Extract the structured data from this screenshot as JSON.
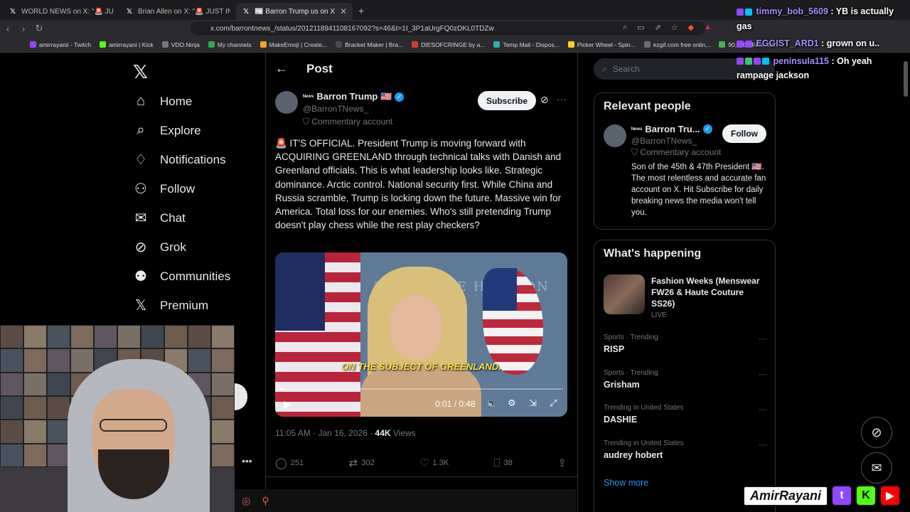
{
  "browser": {
    "tabs": [
      {
        "title": "WORLD NEWS on X: \"🚨 JUST IN:",
        "active": false
      },
      {
        "title": "Brian Allen on X: \"🚨 JUST IN: Xi Jinp",
        "active": false
      },
      {
        "title": "📰 Barron Trump us on X: \"🚨 I",
        "active": true
      }
    ],
    "url": "x.com/barrontnews_/status/2012118941108167092?s=46&t=1I_3P1aUrgFQ0zDKL0TDZw",
    "bookmarks": [
      {
        "label": "amirrayanii - Twitch",
        "color": "#9146ff"
      },
      {
        "label": "amirrayani | Kick",
        "color": "#53fc18"
      },
      {
        "label": "VDO.Ninja",
        "color": "#777777"
      },
      {
        "label": "My channels",
        "color": "#34a853"
      },
      {
        "label": "MakeEmoji | Create...",
        "color": "#f4a31b"
      },
      {
        "label": "Bracket Maker | Bra...",
        "color": "#4a4a4a"
      },
      {
        "label": "DIESOFCRINGE by a...",
        "color": "#d33b3b"
      },
      {
        "label": "Temp Mail - Dispos...",
        "color": "#2ab1a8"
      },
      {
        "label": "Picker Wheel - Spin...",
        "color": "#f4d21b"
      },
      {
        "label": "ezgif.com free onlin...",
        "color": "#6d6d6d"
      },
      {
        "label": "90,000+ Free So...",
        "color": "#4caf50"
      }
    ]
  },
  "nav": {
    "items": [
      {
        "label": "Home",
        "icon": "⌂"
      },
      {
        "label": "Explore",
        "icon": "⌕"
      },
      {
        "label": "Notifications",
        "icon": "♢"
      },
      {
        "label": "Follow",
        "icon": "⚇"
      },
      {
        "label": "Chat",
        "icon": "✉"
      },
      {
        "label": "Grok",
        "icon": "⊘"
      },
      {
        "label": "Communities",
        "icon": "⚉"
      },
      {
        "label": "Premium",
        "icon": "𝕏"
      }
    ]
  },
  "post": {
    "header_title": "Post",
    "author_name": "Barron Trump 🇺🇸",
    "author_prefix": "ᴺᵉʷˢ",
    "handle": "@BarronTNews_",
    "account_type": "Commentary account",
    "subscribe_label": "Subscribe",
    "body": "🚨 IT'S OFFICIAL. President Trump is moving forward with ACQUIRING GREENLAND through technical talks with Danish and Greenland officials. This is what leadership looks like. Strategic dominance. Arctic control. National security first. While China and Russia scramble, Trump is locking down the future. Massive win for America. Total loss for our enemies. Who's still pretending Trump doesn't play chess while the rest play checkers?",
    "video": {
      "caption": "ON THE SUBJECT OF GREENLAND.",
      "wall_text": "THE WHITE HO     GTON",
      "time": "0:01 / 0:48",
      "progress": 0.02
    },
    "timestamp": "11:05 AM · Jan 16, 2026 · ",
    "views_count": "44K",
    "views_label": " Views",
    "replies": "251",
    "reposts": "302",
    "likes": "1.3K",
    "bookmarks": "38"
  },
  "search": {
    "placeholder": "Search"
  },
  "relevant": {
    "title": "Relevant people",
    "name": "Barron Tru...",
    "prefix": "ᴺᵉʷˢ",
    "handle": "@BarronTNews_",
    "account_type": "Commentary account",
    "follow_label": "Follow",
    "bio": "Son of the 45th & 47th President 🇺🇸. The most relentless and accurate fan account on X. Hit Subscribe for daily breaking news the media won't tell you."
  },
  "happening": {
    "title": "What's happening",
    "featured": {
      "title": "Fashion Weeks (Menswear FW26 & Haute Couture SS26)",
      "status": "LIVE"
    },
    "trends": [
      {
        "context": "Sports · Trending",
        "name": "RISP"
      },
      {
        "context": "Sports · Trending",
        "name": "Grisham"
      },
      {
        "context": "Trending in United States",
        "name": "DASHIE"
      },
      {
        "context": "Trending in United States",
        "name": "audrey hobert"
      }
    ],
    "show_more": "Show more"
  },
  "chat": [
    {
      "user": "timmy_bob_5609",
      "msg": " : YB is actually gas"
    },
    {
      "user": "EGGIST_ARD1",
      "msg": " : grown on u..",
      "highlight": true
    },
    {
      "user": "peninsula115",
      "msg": " : Oh yeah rampage jackson"
    }
  ],
  "brand": {
    "name": "AmirRayani",
    "twitch": "t",
    "kick": "K",
    "youtube": "▶"
  }
}
